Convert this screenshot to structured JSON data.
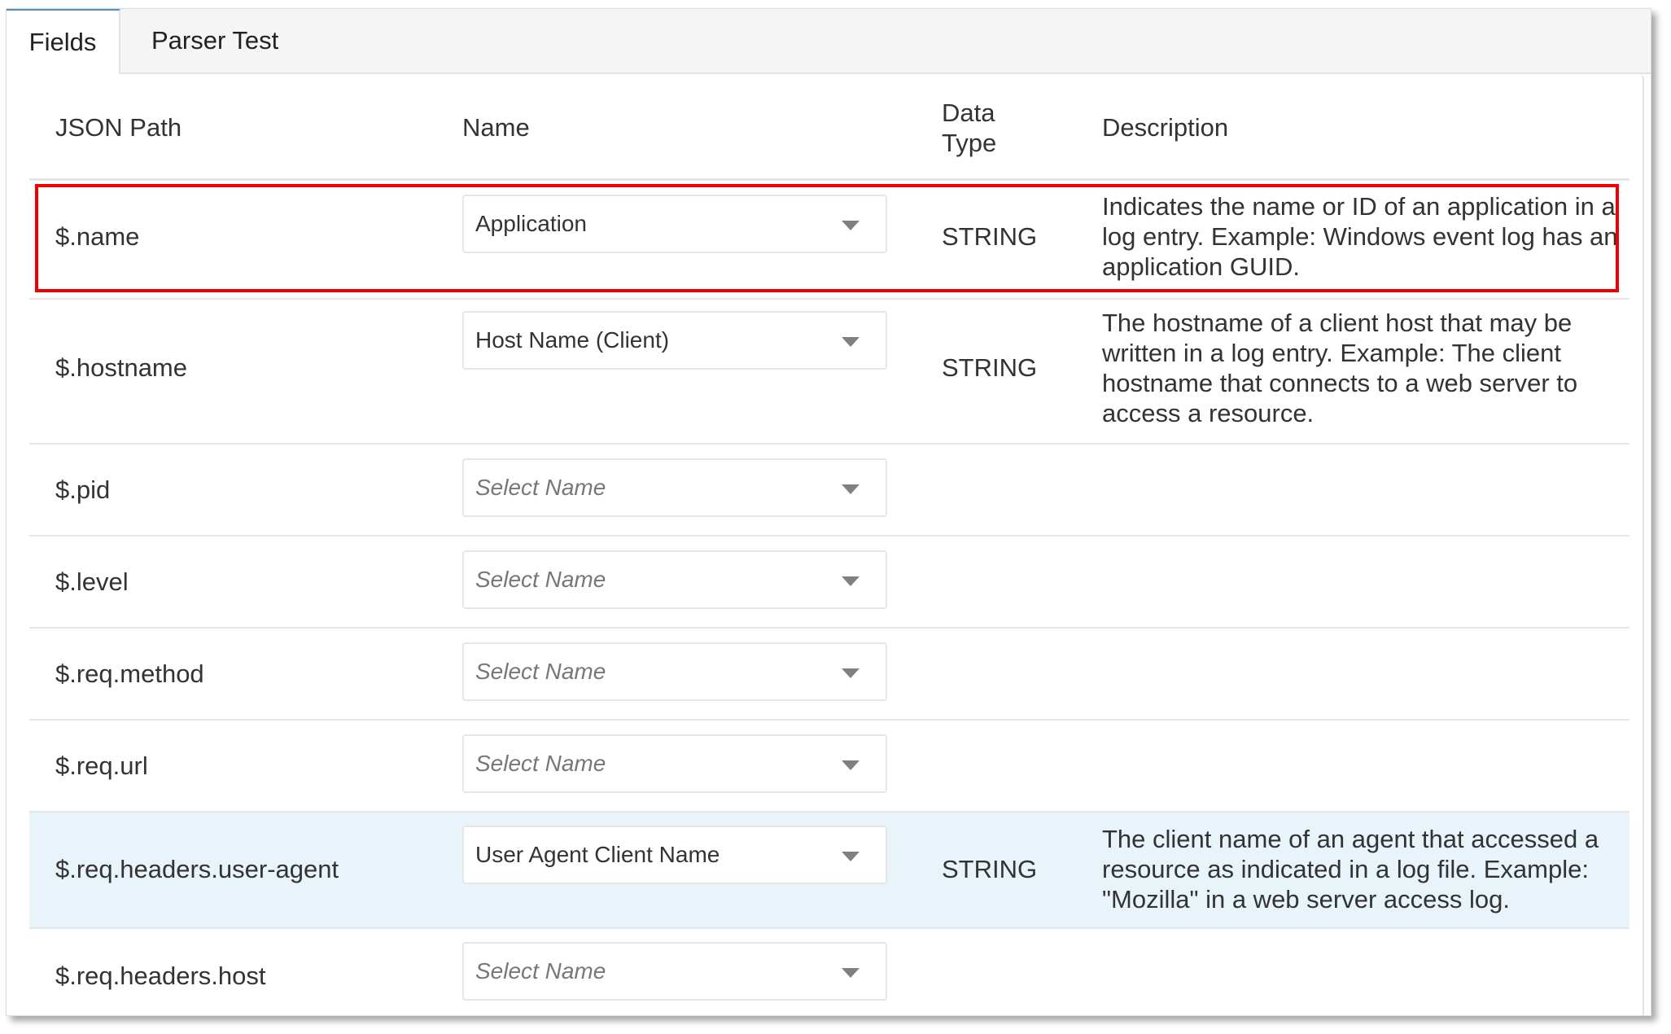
{
  "tabs": [
    {
      "label": "Fields",
      "active": true
    },
    {
      "label": "Parser Test",
      "active": false
    }
  ],
  "table": {
    "headers": {
      "json_path": "JSON Path",
      "name": "Name",
      "data_type_line1": "Data",
      "data_type_line2": "Type",
      "description": "Description"
    },
    "rows": [
      {
        "json_path": "$.name",
        "name": "Application",
        "name_is_placeholder": false,
        "data_type": "STRING",
        "description": "Indicates the name or ID of an application in a log entry. Example: Windows event log has an application GUID.",
        "outlined": true
      },
      {
        "json_path": "$.hostname",
        "name": "Host Name (Client)",
        "name_is_placeholder": false,
        "data_type": "STRING",
        "description": "The hostname of a client host that may be written in a log entry. Example: The client hostname that connects to a web server to access a resource."
      },
      {
        "json_path": "$.pid",
        "name": "Select Name",
        "name_is_placeholder": true,
        "data_type": "",
        "description": ""
      },
      {
        "json_path": "$.level",
        "name": "Select Name",
        "name_is_placeholder": true,
        "data_type": "",
        "description": ""
      },
      {
        "json_path": "$.req.method",
        "name": "Select Name",
        "name_is_placeholder": true,
        "data_type": "",
        "description": ""
      },
      {
        "json_path": "$.req.url",
        "name": "Select Name",
        "name_is_placeholder": true,
        "data_type": "",
        "description": ""
      },
      {
        "json_path": "$.req.headers.user-agent",
        "name": "User Agent Client Name",
        "name_is_placeholder": false,
        "data_type": "STRING",
        "description": "The client name of an agent that accessed a resource as indicated in a log file. Example: \"Mozilla\" in a web server access log.",
        "highlighted": true
      },
      {
        "json_path": "$.req.headers.host",
        "name": "Select Name",
        "name_is_placeholder": true,
        "data_type": "",
        "description": ""
      }
    ]
  },
  "colors": {
    "highlight_box": "#ee0000",
    "selected_row_bg": "#e8f3fa",
    "active_tab_accent": "#4a90c8"
  }
}
